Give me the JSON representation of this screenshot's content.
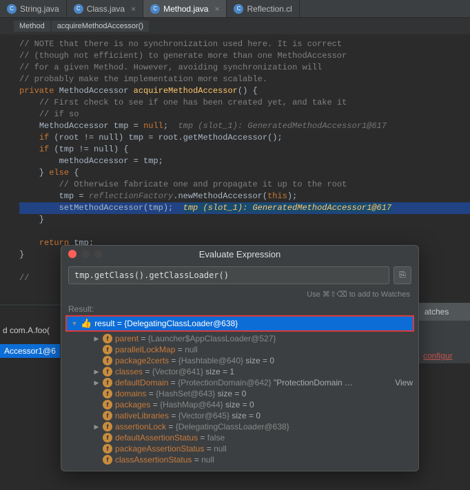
{
  "tabs": [
    {
      "label": "String.java",
      "active": false
    },
    {
      "label": "Class.java",
      "active": false
    },
    {
      "label": "Method.java",
      "active": true
    },
    {
      "label": "Reflection.cl",
      "active": false
    }
  ],
  "breadcrumb": [
    "Method",
    "acquireMethodAccessor()"
  ],
  "code": {
    "c1": "// NOTE that there is no synchronization used here. It is correct",
    "c2": "// (though not efficient) to generate more than one MethodAccessor",
    "c3": "// for a given Method. However, avoiding synchronization will",
    "c4": "// probably make the implementation more scalable.",
    "kw_private": "private",
    "type_ma": "MethodAccessor",
    "m_acquire": "acquireMethodAccessor",
    "c5": "// First check to see if one has been created yet, and take it",
    "c6": "// if so",
    "kw_null": "null",
    "hint1": "tmp (slot_1): GeneratedMethodAccessor1@617",
    "kw_if": "if",
    "kw_else": "else",
    "kw_return": "return",
    "l_root": "(root != null) tmp = root.getMethodAccessor();",
    "l_tmpnn": "(tmp != null) {",
    "l_assign": "methodAccessor = tmp;",
    "c7": "// Otherwise fabricate one and propagate it up to the root",
    "l_fab_a": "tmp = ",
    "l_fab_b": "reflectionFactory",
    "l_fab_c": ".newMethodAccessor(",
    "l_fab_d": "this",
    "l_fab_e": ");",
    "l_set": "setMethodAccessor(tmp);",
    "hint2": "tmp (slot_1): GeneratedMethodAccessor1@617",
    "l_ret": " tmp;",
    "l_slash": "//"
  },
  "dialog": {
    "title": "Evaluate Expression",
    "input_value": "tmp.getClass().getClassLoader()",
    "hint": "Use ⌘⇧⌫ to add to Watches",
    "result_label": "Result:",
    "result_name": "result",
    "result_value": "{DelegatingClassLoader@638}",
    "fields": [
      {
        "indent": 1,
        "arrow": true,
        "name": "parent",
        "value": "{Launcher$AppClassLoader@527}"
      },
      {
        "indent": 1,
        "arrow": false,
        "name": "parallelLockMap",
        "value": "null"
      },
      {
        "indent": 1,
        "arrow": false,
        "name": "package2certs",
        "value": "{Hashtable@640}",
        "extra": " size = 0"
      },
      {
        "indent": 1,
        "arrow": true,
        "name": "classes",
        "value": "{Vector@641}",
        "extra": " size = 1"
      },
      {
        "indent": 1,
        "arrow": true,
        "name": "defaultDomain",
        "value": "{ProtectionDomain@642}",
        "extra": " \"ProtectionDomain  …",
        "view": true
      },
      {
        "indent": 1,
        "arrow": false,
        "name": "domains",
        "value": "{HashSet@643}",
        "extra": " size = 0"
      },
      {
        "indent": 1,
        "arrow": false,
        "name": "packages",
        "value": "{HashMap@644}",
        "extra": " size = 0"
      },
      {
        "indent": 1,
        "arrow": false,
        "name": "nativeLibraries",
        "value": "{Vector@645}",
        "extra": " size = 0"
      },
      {
        "indent": 1,
        "arrow": true,
        "name": "assertionLock",
        "value": "{DelegatingClassLoader@638}"
      },
      {
        "indent": 1,
        "arrow": false,
        "name": "defaultAssertionStatus",
        "value": "false"
      },
      {
        "indent": 1,
        "arrow": false,
        "name": "packageAssertionStatus",
        "value": "null"
      },
      {
        "indent": 1,
        "arrow": false,
        "name": "classAssertionStatus",
        "value": "null"
      }
    ]
  },
  "side": {
    "watches": "atches",
    "config": "configur"
  },
  "left": {
    "frame": "d com.A.foo(",
    "val": "Accessor1@6"
  }
}
